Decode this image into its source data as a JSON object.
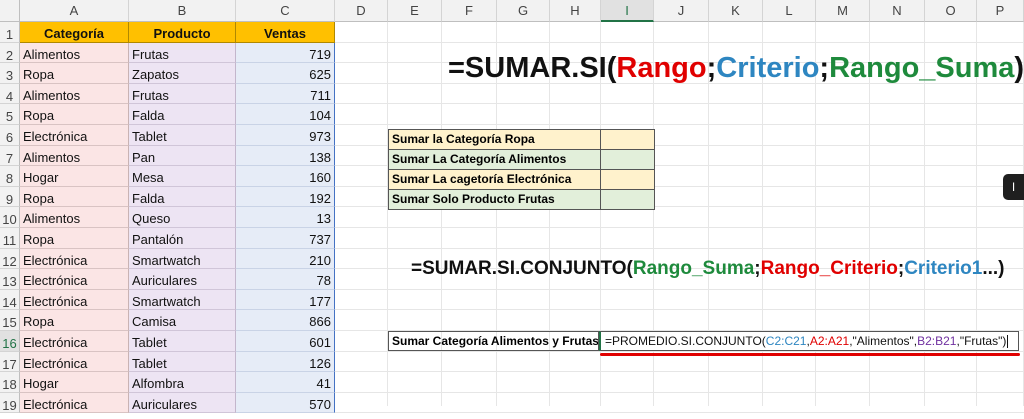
{
  "columns": [
    "A",
    "B",
    "C",
    "D",
    "E",
    "F",
    "G",
    "H",
    "I",
    "J",
    "K",
    "L",
    "M",
    "N",
    "O",
    "P"
  ],
  "rows": [
    "1",
    "2",
    "3",
    "4",
    "5",
    "6",
    "7",
    "8",
    "9",
    "10",
    "11",
    "12",
    "13",
    "14",
    "15",
    "16",
    "17",
    "18",
    "19"
  ],
  "headers": {
    "categoria": "Categoría",
    "producto": "Producto",
    "ventas": "Ventas"
  },
  "data": [
    {
      "cat": "Alimentos",
      "prod": "Frutas",
      "ventas": "719"
    },
    {
      "cat": "Ropa",
      "prod": "Zapatos",
      "ventas": "625"
    },
    {
      "cat": "Alimentos",
      "prod": "Frutas",
      "ventas": "711"
    },
    {
      "cat": "Ropa",
      "prod": "Falda",
      "ventas": "104"
    },
    {
      "cat": "Electrónica",
      "prod": "Tablet",
      "ventas": "973"
    },
    {
      "cat": "Alimentos",
      "prod": "Pan",
      "ventas": "138"
    },
    {
      "cat": "Hogar",
      "prod": "Mesa",
      "ventas": "160"
    },
    {
      "cat": "Ropa",
      "prod": "Falda",
      "ventas": "192"
    },
    {
      "cat": "Alimentos",
      "prod": "Queso",
      "ventas": "13"
    },
    {
      "cat": "Ropa",
      "prod": "Pantalón",
      "ventas": "737"
    },
    {
      "cat": "Electrónica",
      "prod": "Smartwatch",
      "ventas": "210"
    },
    {
      "cat": "Electrónica",
      "prod": "Auriculares",
      "ventas": "78"
    },
    {
      "cat": "Electrónica",
      "prod": "Smartwatch",
      "ventas": "177"
    },
    {
      "cat": "Ropa",
      "prod": "Camisa",
      "ventas": "866"
    },
    {
      "cat": "Electrónica",
      "prod": "Tablet",
      "ventas": "601"
    },
    {
      "cat": "Electrónica",
      "prod": "Tablet",
      "ventas": "126"
    },
    {
      "cat": "Hogar",
      "prod": "Alfombra",
      "ventas": "41"
    },
    {
      "cat": "Electrónica",
      "prod": "Auriculares",
      "ventas": "570"
    }
  ],
  "formula1": {
    "prefix": "=SUMAR.SI(",
    "rango": "Rango",
    "sep1": ";",
    "criterio": "Criterio",
    "sep2": ";",
    "rango_suma": "Rango_Suma",
    "suffix": ")"
  },
  "summary_table": [
    {
      "label": "Sumar la Categoría Ropa",
      "color": "#fff2cc"
    },
    {
      "label": "Sumar La Categoría Alimentos",
      "color": "#e2efda"
    },
    {
      "label": "Sumar La cagetoría Electrónica",
      "color": "#fff2cc"
    },
    {
      "label": "Sumar Solo Producto Frutas",
      "color": "#e2efda"
    }
  ],
  "formula2": {
    "prefix": "=SUMAR.SI.CONJUNTO(",
    "rango_suma": "Rango_Suma",
    "sep1": ";",
    "rango_criterio": "Rango_Criterio",
    "sep2": ";",
    "criterio1": "Criterio1",
    "suffix": "...)"
  },
  "row16": {
    "label": "Sumar Categoría Alimentos y Frutas",
    "formula": {
      "fn": "=PROMEDIO.SI.CONJUNTO(",
      "r1": "C2:C21",
      "c1": ",",
      "r2": "A2:A21",
      "c2": ",",
      "s1": "\"Alimentos\"",
      "c3": ",",
      "r3": "B2:B21",
      "c4": ",",
      "s2": "\"Frutas\"",
      "end": ")"
    }
  },
  "colors": {
    "red": "#e00000",
    "blue": "#2e86c1",
    "green": "#1e8a3c",
    "purple": "#7030a0",
    "header_fill": "#ffc000"
  },
  "side_pill": "I"
}
